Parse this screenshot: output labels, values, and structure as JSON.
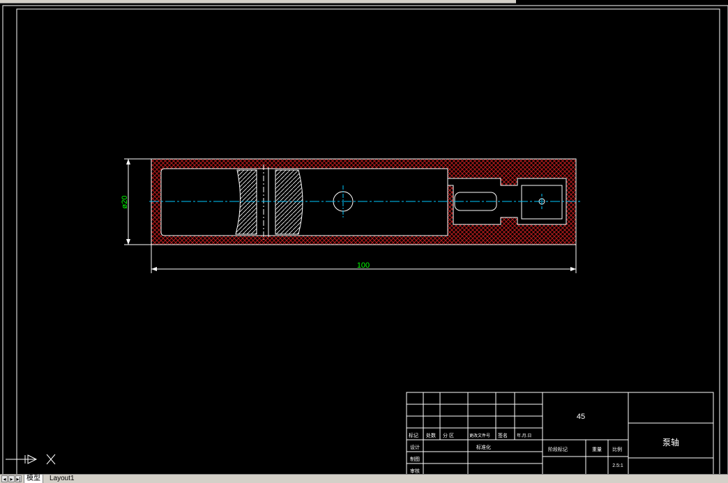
{
  "drawing": {
    "dimension_diameter": "ø20",
    "dimension_length": "100",
    "material": "45",
    "part_name": "泵轴",
    "scale": "2.5:1"
  },
  "title_block": {
    "row_labels": [
      "标记",
      "处数",
      "分 区",
      "更改文件号",
      "签名",
      "年.月.日"
    ],
    "design": "设计",
    "standardize": "标准化",
    "draft": "制图",
    "review": "审核",
    "stage_mark": "阶段标记",
    "weight": "重量",
    "scale_label": "比例"
  },
  "tabs": {
    "model": "模型",
    "layout1": "Layout1"
  },
  "colors": {
    "background": "#000000",
    "lines": "#ffffff",
    "hatch": "#b81c1c",
    "centerline": "#00c8ff",
    "dimension": "#00ff00"
  }
}
